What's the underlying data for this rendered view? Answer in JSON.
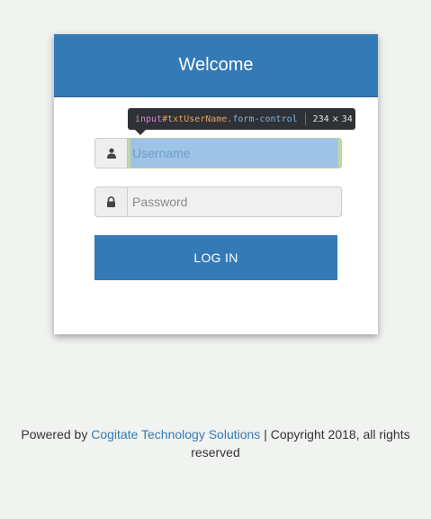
{
  "login_card": {
    "title": "Welcome",
    "username": {
      "placeholder": "Username",
      "value": "",
      "icon": "user-icon"
    },
    "password": {
      "placeholder": "Password",
      "value": "",
      "icon": "lock-icon"
    },
    "login_button_label": "LOG IN"
  },
  "devtools_tooltip": {
    "tag": "input",
    "id": "#txtUserName",
    "class": ".form-control",
    "size": "234 × 34"
  },
  "footer": {
    "prefix": "Powered by ",
    "link_text": "Cogitate Technology Solutions",
    "suffix": " | Copyright 2018, all rights",
    "line2": "reserved"
  },
  "colors": {
    "primary": "#337ab7",
    "background": "#f1f3f1",
    "highlight_overlay": "#9fc3e6"
  }
}
